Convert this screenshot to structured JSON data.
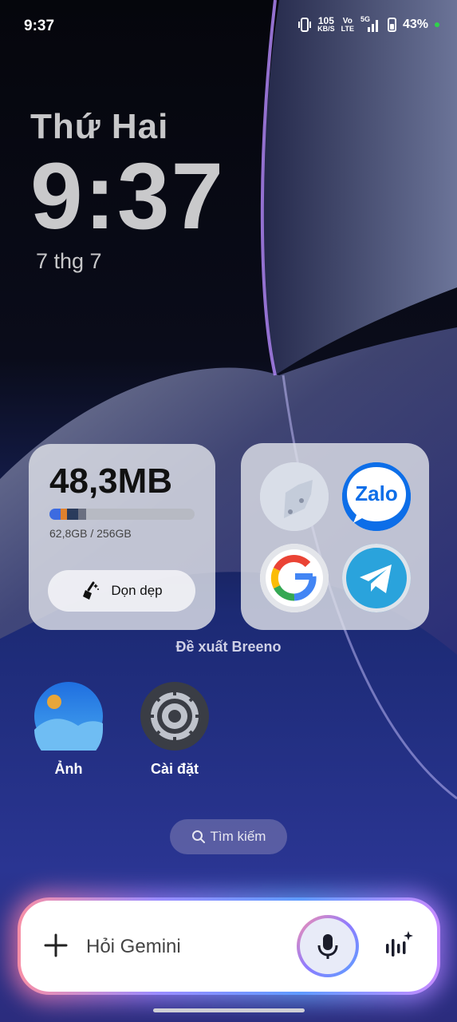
{
  "status_bar": {
    "time": "9:37",
    "net_speed_value": "105",
    "net_speed_unit": "KB/S",
    "volte_top": "Vo",
    "volte_bottom": "LTE",
    "signal_label": "5G",
    "battery_percent": "43%"
  },
  "clock_widget": {
    "day_name": "Thứ Hai",
    "time": "9:37",
    "date": "7 thg 7"
  },
  "storage_widget": {
    "amount": "48,3MB",
    "usage_text": "62,8GB / 256GB",
    "used_fraction": 0.245,
    "clean_button_label": "Dọn dẹp"
  },
  "app_folder": {
    "label": "Đề xuất Breeno",
    "apps": [
      "app-1",
      "Zalo",
      "Google",
      "Telegram"
    ],
    "zalo_logo_text": "Zalo"
  },
  "home_apps": [
    {
      "label": "Ảnh",
      "icon": "photos-icon"
    },
    {
      "label": "Cài đặt",
      "icon": "settings-icon"
    }
  ],
  "search": {
    "label": "Tìm kiếm"
  },
  "gemini_bar": {
    "placeholder": "Hỏi Gemini"
  }
}
